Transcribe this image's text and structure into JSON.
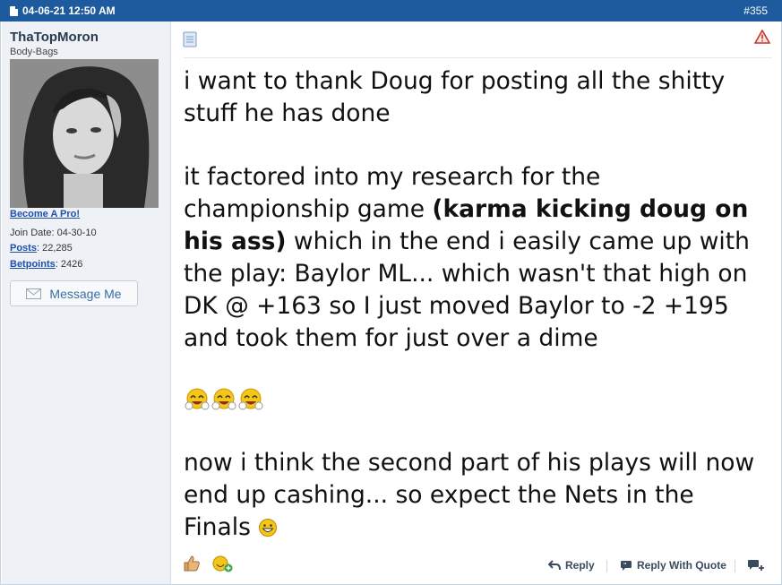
{
  "header": {
    "date": "04-06-21 12:50 AM",
    "post_number": "#355"
  },
  "user": {
    "name": "ThaTopMoron",
    "title": "Body-Bags",
    "become_pro": "Become A Pro!",
    "join_label": "Join Date:",
    "join_date": "04-30-10",
    "posts_label": "Posts",
    "posts": "22,285",
    "betpoints_label": "Betpoints",
    "betpoints": "2426",
    "message_button": "Message Me"
  },
  "post": {
    "p1": "i want to thank Doug for posting all the shitty stuff he has done",
    "p2_a": "it factored into my research for the championship game ",
    "p2_bold": "(karma kicking doug on his ass)",
    "p2_b": " which in the end i easily came up with the play: Baylor ML... which wasn't that high on DK @ +163 so I just moved Baylor to -2 +195 and took them for just over a dime",
    "p3": "now i think the second part of his plays will now end up cashing... so expect the Nets in the Finals"
  },
  "footer": {
    "reply": "Reply",
    "reply_quote": "Reply With Quote"
  },
  "colors": {
    "header_bg": "#1d5a9e",
    "link": "#1f4fa8",
    "sidebar_bg": "#eef2f6"
  },
  "icons": [
    "document-icon",
    "report-icon",
    "laughing-emoji-icon",
    "grin-emoji-icon",
    "thumbs-up-icon",
    "add-reaction-icon",
    "reply-arrow-icon",
    "quote-icon",
    "multi-quote-icon",
    "envelope-icon"
  ]
}
